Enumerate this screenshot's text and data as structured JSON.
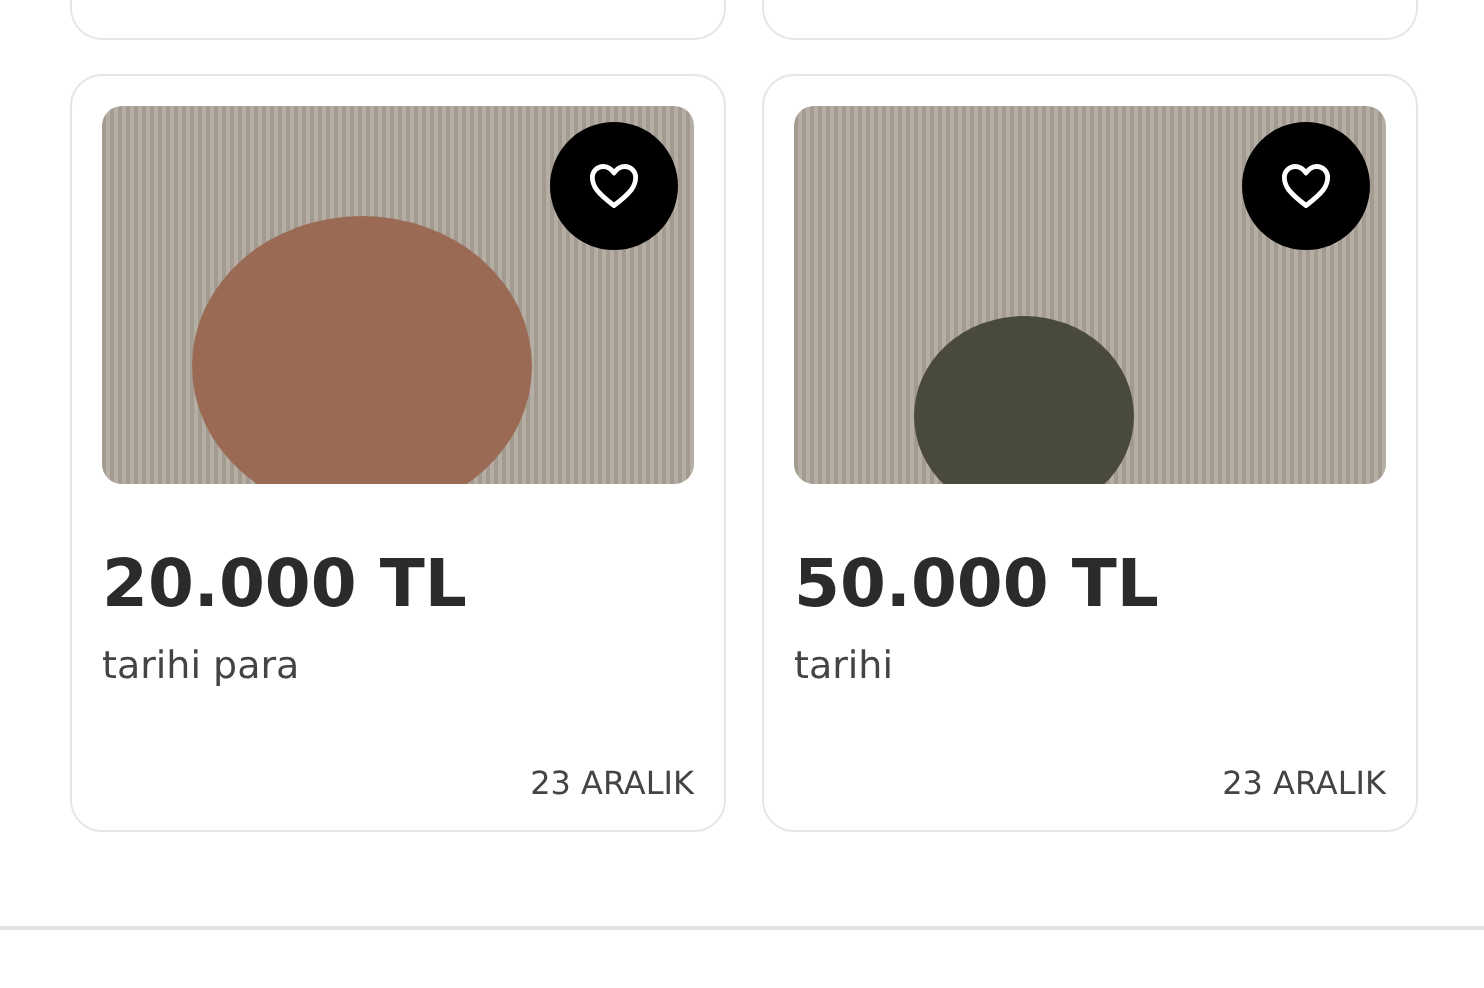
{
  "listings": [
    {
      "price": "20.000 TL",
      "title": "tarihi para",
      "date": "23 ARALIK",
      "favorite": false
    },
    {
      "price": "50.000 TL",
      "title": "tarihi",
      "date": "23 ARALIK",
      "favorite": false
    }
  ]
}
